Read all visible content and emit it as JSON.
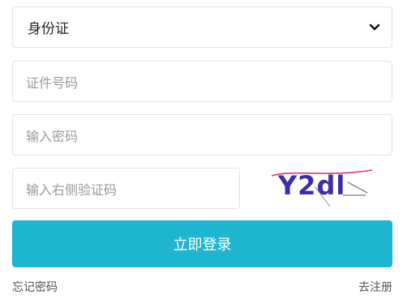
{
  "id_type_select": {
    "selected": "身份证",
    "icon": "chevron-down-icon"
  },
  "id_number_input": {
    "placeholder": "证件号码",
    "value": ""
  },
  "password_input": {
    "placeholder": "输入密码",
    "value": ""
  },
  "captcha_input": {
    "placeholder": "输入右侧验证码",
    "value": ""
  },
  "captcha_image": {
    "text": "Y2dl"
  },
  "login_button": {
    "label": "立即登录"
  },
  "links": {
    "forgot_password": "忘记密码",
    "register": "去注册"
  },
  "colors": {
    "primary": "#1fb5cf",
    "captcha_text": "#3a2fa8",
    "captcha_noise": "#e0356d"
  }
}
